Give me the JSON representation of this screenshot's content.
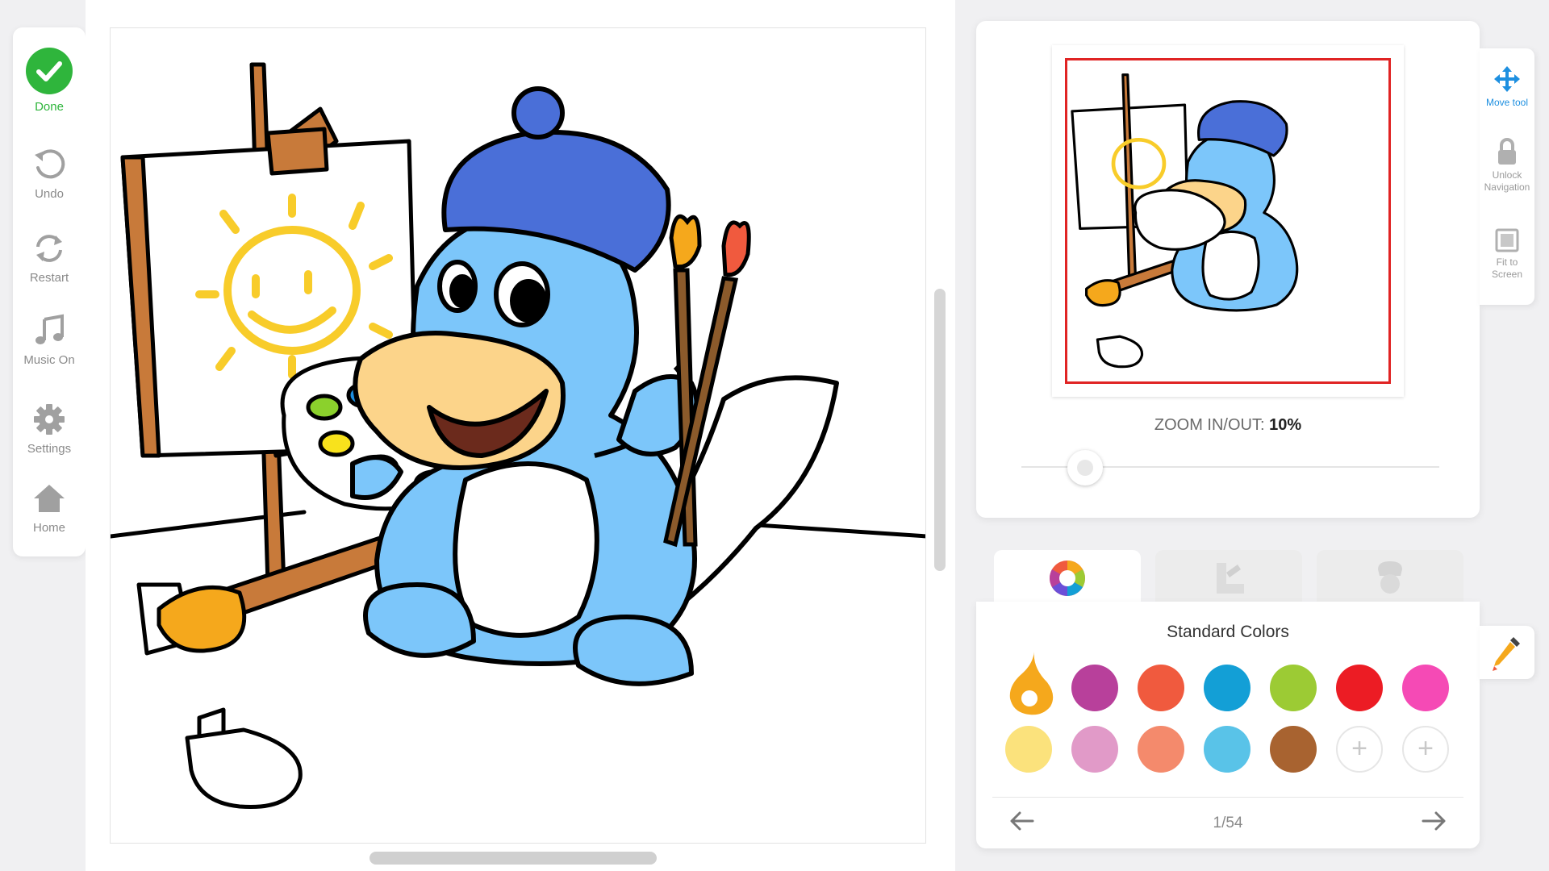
{
  "left_toolbar": {
    "items": [
      {
        "label": "Done",
        "icon": "check-icon"
      },
      {
        "label": "Undo",
        "icon": "undo-icon"
      },
      {
        "label": "Restart",
        "icon": "restart-icon"
      },
      {
        "label": "Music On",
        "icon": "music-note-icon"
      },
      {
        "label": "Settings",
        "icon": "gear-icon"
      },
      {
        "label": "Home",
        "icon": "home-icon"
      }
    ]
  },
  "navigator": {
    "zoom_label": "ZOOM IN/OUT:",
    "zoom_value": "10%",
    "zoom_slider_level": 0.1
  },
  "right_tools": {
    "items": [
      {
        "label_line1": "Move tool",
        "label_line2": "",
        "icon": "move-icon",
        "active": true
      },
      {
        "label_line1": "Unlock",
        "label_line2": "Navigation",
        "icon": "lock-icon",
        "active": false
      },
      {
        "label_line1": "Fit to",
        "label_line2": "Screen",
        "icon": "fit-screen-icon",
        "active": false
      }
    ]
  },
  "color_tabs": [
    {
      "icon": "color-wheel-icon",
      "active": true
    },
    {
      "icon": "ruler-icon",
      "active": false
    },
    {
      "icon": "chef-hat-icon",
      "active": false
    }
  ],
  "colors": {
    "title": "Standard Colors",
    "selected": "#f5a81c",
    "row1": [
      "#f5a81c",
      "#b8409b",
      "#f05a3e",
      "#139fd6",
      "#9ccb34",
      "#ec1c24",
      "#f54ab5"
    ],
    "row2": [
      "#fbe27c",
      "#e19ac8",
      "#f48a6c",
      "#59c3e8",
      "#a86330",
      "add",
      "add"
    ],
    "page": "1/54"
  },
  "accent_colors": {
    "done_green": "#2fb53c",
    "active_blue": "#1d8fe0",
    "viewport_red": "#e02424"
  }
}
